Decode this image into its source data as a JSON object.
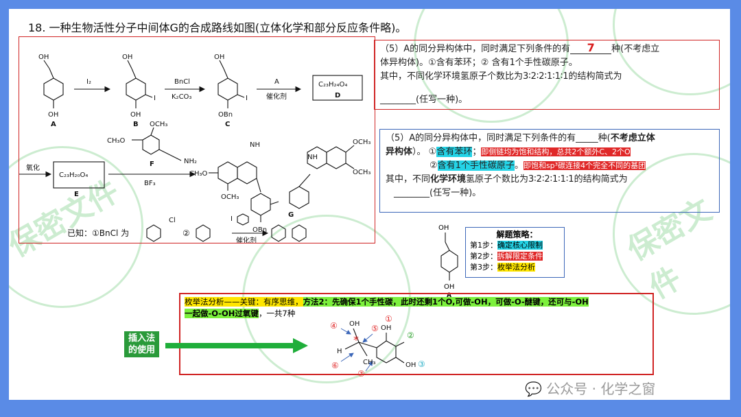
{
  "title": "18. 一种生物活性分子中间体G的合成路线如图(立体化学和部分反应条件略)。",
  "scheme": {
    "labels": {
      "A": "A",
      "B": "B",
      "C": "C",
      "D": "D",
      "E": "E",
      "F": "F",
      "G": "G"
    },
    "reagents": {
      "i2": "I₂",
      "bncl": "BnCl",
      "k2co3": "K₂CO₃",
      "a": "A",
      "catalyst": "催化剂",
      "d_formula": "C₂₃H₂₄O₄",
      "e_formula": "C₂₃H₂₀O₄",
      "oxidation": "氧化",
      "bf3": "BF₃"
    },
    "groups": {
      "oh": "OH",
      "i": "I",
      "obn": "OBn",
      "och3": "OCH₃",
      "nh2": "NH₂",
      "ch3o": "CH₃O",
      "nh": "NH",
      "cl": "Cl"
    },
    "known": {
      "prefix": "已知：①BnCl 为",
      "circ2": "②",
      "catalyst": "催化剂"
    }
  },
  "question_box": {
    "line1_pre": "（5）A的同分异构体中，同时满足下列条件的有",
    "answer": "7",
    "line1_post": "种(不考虑立",
    "line2": "体异构体)。①含有苯环；② 含有1个手性碳原子。",
    "line3": "其中，不同化学环境氢原子个数比为3∶2∶2∶1∶1∶1的结构简式为",
    "line4": "________(任写一种)。"
  },
  "analysis_box": {
    "l1_pre": "（5）A的同分异构体中，同时满足下列条件的有_____种(",
    "l1_bold": "不考虑立体",
    "l2_bold": "异构体",
    "l2_mid": "）。 ①",
    "l2_cyan": "含有苯环",
    "l2_sep": "；",
    "l2_red": "即侧链均为饱和结构，总共2个额外C、2个O",
    "l3_pre": "②",
    "l3_cyan": "含有1个手性碳原子",
    "l3_sep": "。",
    "l3_red": "即饱和sp³碳连接4个完全不同的基团",
    "l4_pre": "其中，不同",
    "l4_bold": "化学环境",
    "l4_post": "氢原子个数比为3∶2∶2∶1∶1∶1的结构简式为",
    "l5": "________(任写一种)。"
  },
  "strategy": {
    "title": "解题策略：",
    "steps": [
      {
        "label": "第1步：",
        "text": "确定核心限制",
        "color": "#24d3e6"
      },
      {
        "label": "第2步：",
        "text": "拆解限定条件",
        "color": "#e02828"
      },
      {
        "label": "第3步：",
        "text": "枚举法分析",
        "color": "#ffe600"
      }
    ]
  },
  "molA": {
    "oh_top": "OH",
    "oh_bottom": "OH",
    "label": "A"
  },
  "enum": {
    "t1_pre": "枚举法分析——关键：有序思维，",
    "t1_green": "方法2：先确保1个手性碳，此时还剩1个O,可做-OH，可做-O-醚键，还可与-OH",
    "t2_green": "一起做-O-OH过氧键",
    "t2_post": "，一共7种",
    "mol": {
      "oh_a": "OH",
      "oh_b": "OH",
      "oh_c": "OH",
      "h": "H",
      "ch3": "CH₃",
      "star": "*",
      "n1": "①",
      "n2": "②",
      "n3": "③",
      "n4": "④",
      "n5": "⑤",
      "n6": "⑥",
      "n7": "⑦"
    }
  },
  "insert_label": {
    "l1": "插入法",
    "l2": "的使用"
  },
  "footer": {
    "icon": "💬",
    "text": "公众号 · 化学之窗"
  },
  "watermark": {
    "text": "保密文件"
  }
}
